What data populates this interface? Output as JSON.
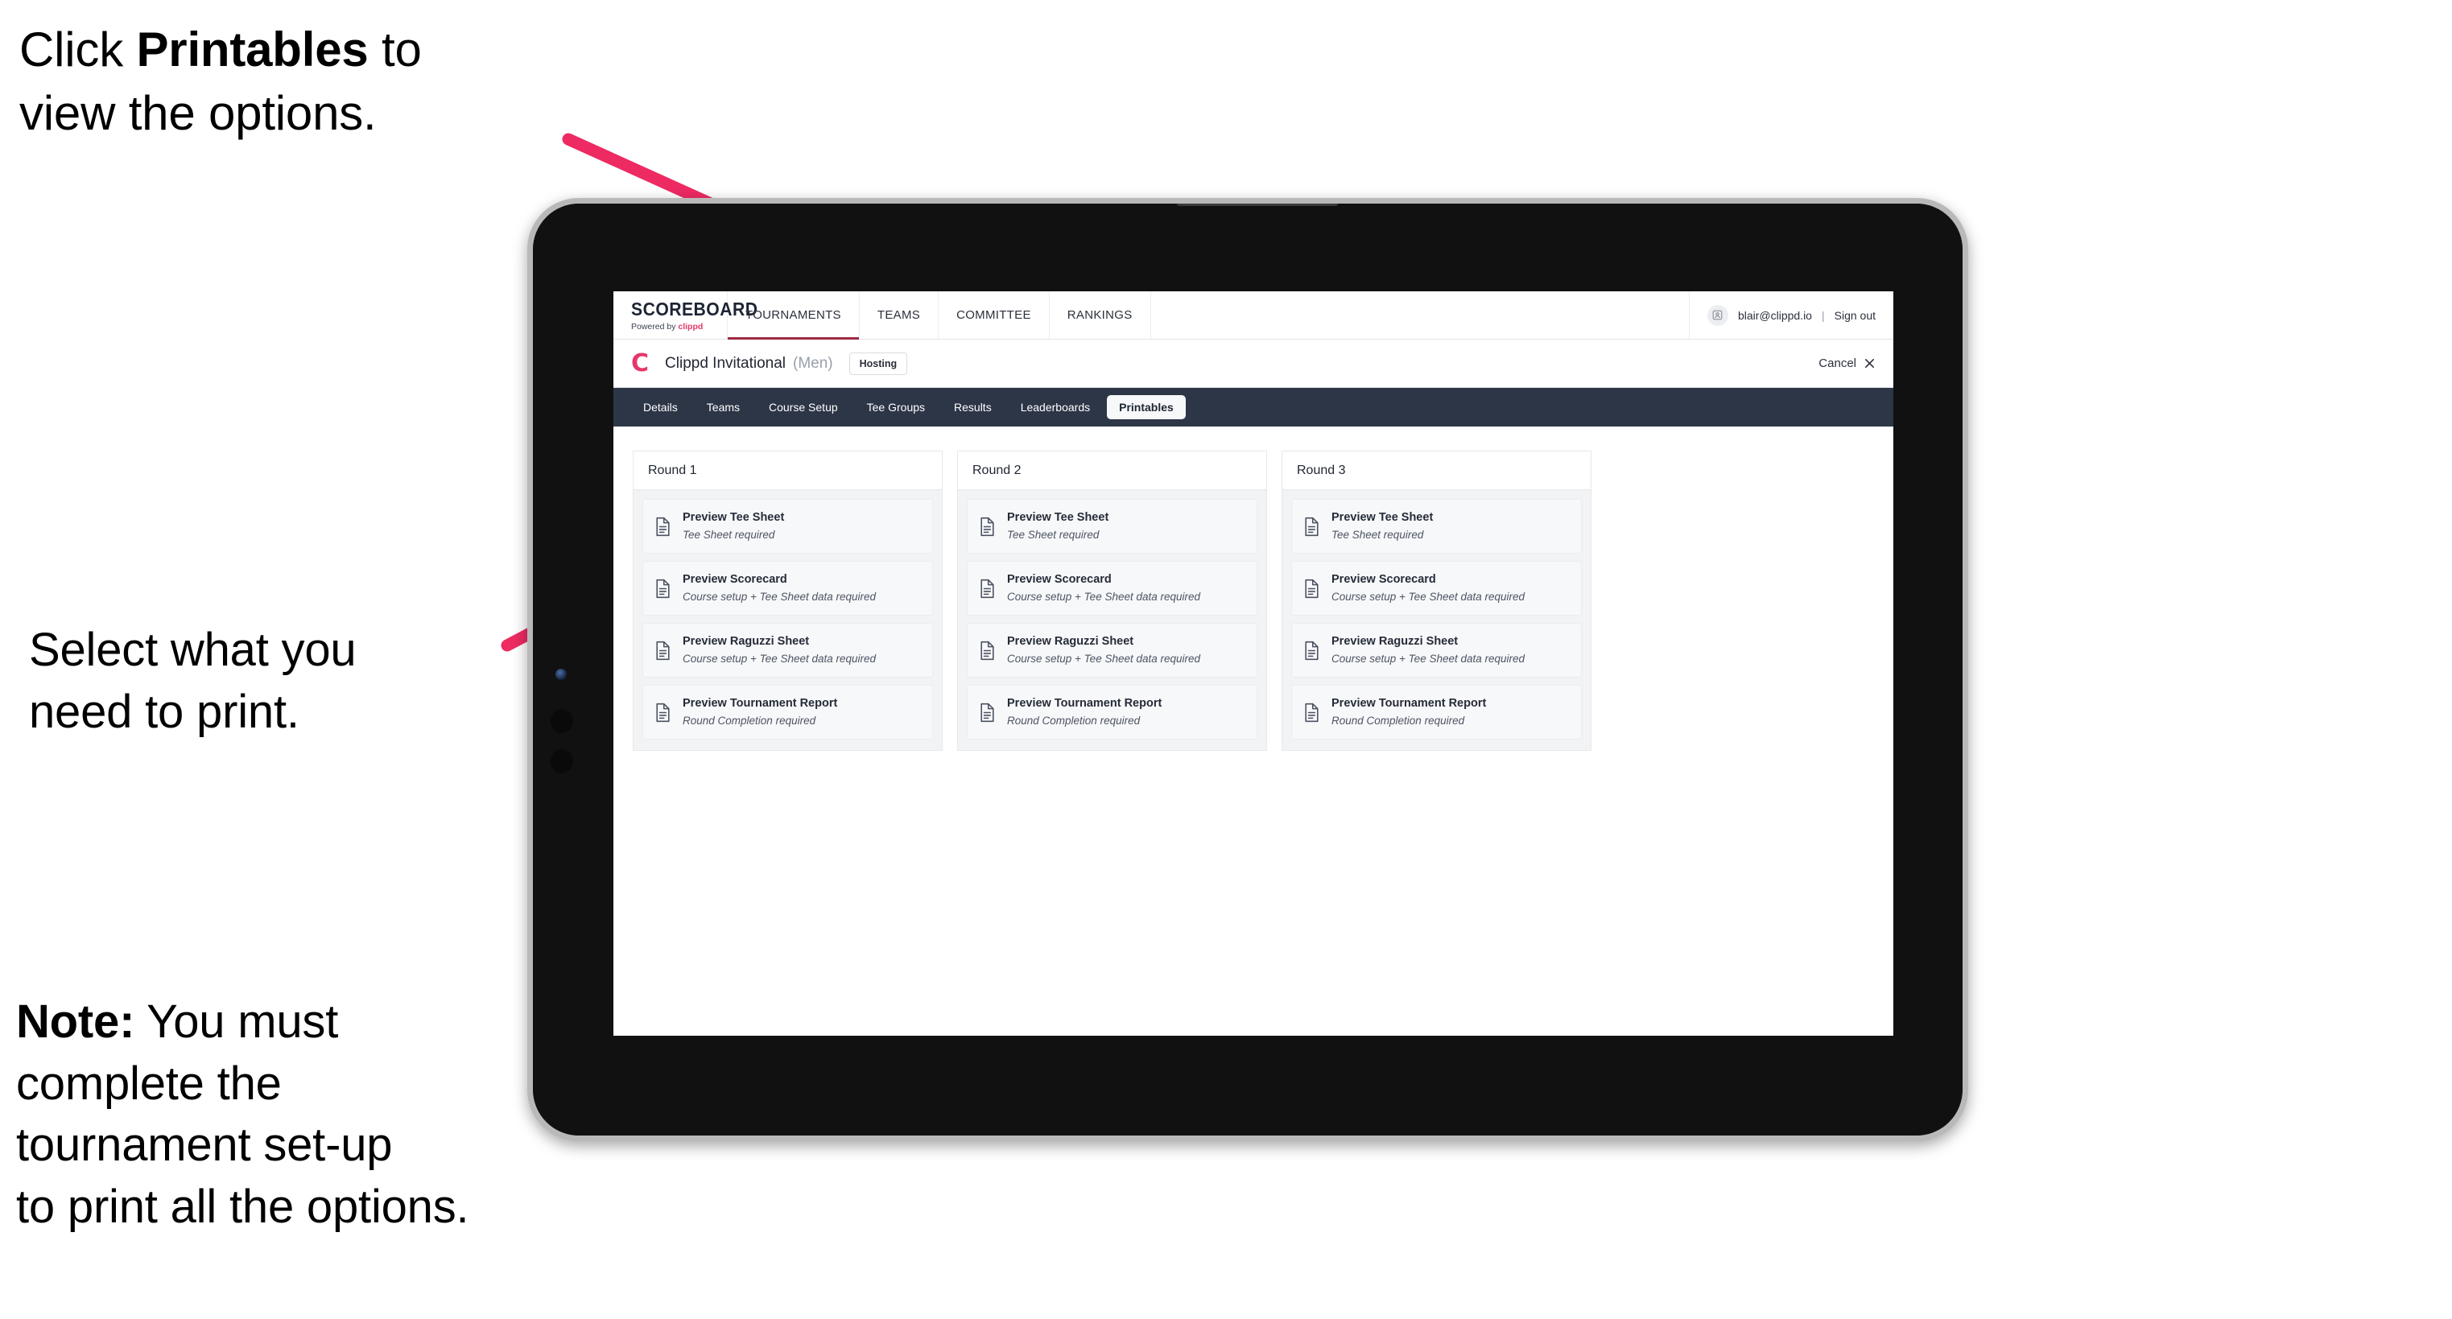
{
  "annotations": {
    "step1_prefix": "Click ",
    "step1_bold": "Printables",
    "step1_suffix": " to\nview the options.",
    "step2": "Select what you\n need to print.",
    "note_bold": "Note:",
    "note_text": " You must\ncomplete the\ntournament set-up\nto print all the options."
  },
  "colors": {
    "arrow_pink": "#ED2A62",
    "brand_pink": "#E5386A",
    "subnav_dark": "#2D3647",
    "active_underline": "#9E2A43"
  },
  "app": {
    "logo": {
      "main": "SCOREBOARD",
      "sub_prefix": "Powered by ",
      "sub_brand": "clippd"
    },
    "topnav": [
      {
        "label": "TOURNAMENTS",
        "active": true
      },
      {
        "label": "TEAMS",
        "active": false
      },
      {
        "label": "COMMITTEE",
        "active": false
      },
      {
        "label": "RANKINGS",
        "active": false
      }
    ],
    "user": {
      "avatar_icon": "user-avatar-icon",
      "email": "blair@clippd.io",
      "separator": "|",
      "signout": "Sign out"
    },
    "tournament": {
      "logo_letter": "C",
      "name": "Clippd Invitational",
      "gender": "(Men)",
      "status_badge": "Hosting",
      "cancel_label": "Cancel",
      "cancel_icon": "close-icon"
    },
    "subnav": [
      {
        "label": "Details",
        "active": false
      },
      {
        "label": "Teams",
        "active": false
      },
      {
        "label": "Course Setup",
        "active": false
      },
      {
        "label": "Tee Groups",
        "active": false
      },
      {
        "label": "Results",
        "active": false
      },
      {
        "label": "Leaderboards",
        "active": false
      },
      {
        "label": "Printables",
        "active": true
      }
    ],
    "rounds": [
      {
        "title": "Round 1",
        "items": [
          {
            "title": "Preview Tee Sheet",
            "sub": "Tee Sheet required",
            "icon": "document-icon"
          },
          {
            "title": "Preview Scorecard",
            "sub": "Course setup + Tee Sheet data required",
            "icon": "document-icon"
          },
          {
            "title": "Preview Raguzzi Sheet",
            "sub": "Course setup + Tee Sheet data required",
            "icon": "document-icon"
          },
          {
            "title": "Preview Tournament Report",
            "sub": "Round Completion required",
            "icon": "document-icon"
          }
        ]
      },
      {
        "title": "Round 2",
        "items": [
          {
            "title": "Preview Tee Sheet",
            "sub": "Tee Sheet required",
            "icon": "document-icon"
          },
          {
            "title": "Preview Scorecard",
            "sub": "Course setup + Tee Sheet data required",
            "icon": "document-icon"
          },
          {
            "title": "Preview Raguzzi Sheet",
            "sub": "Course setup + Tee Sheet data required",
            "icon": "document-icon"
          },
          {
            "title": "Preview Tournament Report",
            "sub": "Round Completion required",
            "icon": "document-icon"
          }
        ]
      },
      {
        "title": "Round 3",
        "items": [
          {
            "title": "Preview Tee Sheet",
            "sub": "Tee Sheet required",
            "icon": "document-icon"
          },
          {
            "title": "Preview Scorecard",
            "sub": "Course setup + Tee Sheet data required",
            "icon": "document-icon"
          },
          {
            "title": "Preview Raguzzi Sheet",
            "sub": "Course setup + Tee Sheet data required",
            "icon": "document-icon"
          },
          {
            "title": "Preview Tournament Report",
            "sub": "Round Completion required",
            "icon": "document-icon"
          }
        ]
      }
    ]
  }
}
